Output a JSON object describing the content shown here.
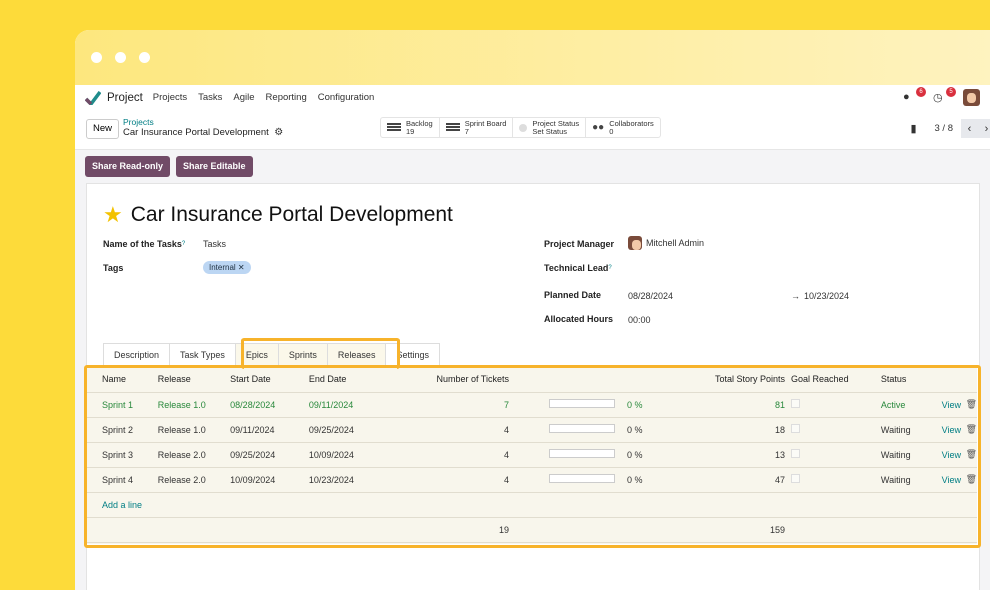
{
  "navbar": {
    "app": "Project",
    "items": [
      "Projects",
      "Tasks",
      "Agile",
      "Reporting",
      "Configuration"
    ],
    "messages_count": "6",
    "activities_count": "5"
  },
  "control_panel": {
    "new_label": "New",
    "breadcrumb_parent": "Projects",
    "breadcrumb_current": "Car Insurance Portal Development",
    "stats": [
      {
        "label": "Backlog",
        "value": "19"
      },
      {
        "label": "Sprint Board",
        "value": "7"
      },
      {
        "label": "Project Status",
        "value": "Set Status"
      },
      {
        "label": "Collaborators",
        "value": "0"
      }
    ],
    "pager": "3 / 8"
  },
  "actions": {
    "share_readonly": "Share Read-only",
    "share_editable": "Share Editable"
  },
  "form": {
    "title": "Car Insurance Portal Development",
    "name_of_tasks_label": "Name of the Tasks",
    "name_of_tasks": "Tasks",
    "tags_label": "Tags",
    "tag": "Internal",
    "project_manager_label": "Project Manager",
    "project_manager": "Mitchell Admin",
    "technical_lead_label": "Technical Lead",
    "planned_date_label": "Planned Date",
    "planned_start": "08/28/2024",
    "planned_end": "10/23/2024",
    "allocated_hours_label": "Allocated Hours",
    "allocated_hours": "00:00"
  },
  "tabs": [
    "Description",
    "Task Types",
    "Epics",
    "Sprints",
    "Releases",
    "Settings"
  ],
  "table": {
    "headers": {
      "name": "Name",
      "release": "Release",
      "start": "Start Date",
      "end": "End Date",
      "tickets": "Number of Tickets",
      "points": "Total Story Points",
      "goal": "Goal Reached",
      "status": "Status"
    },
    "rows": [
      {
        "name": "Sprint 1",
        "release": "Release 1.0",
        "start": "08/28/2024",
        "end": "09/11/2024",
        "tickets": "7",
        "progress": "0 %",
        "points": "81",
        "status": "Active",
        "view": "View"
      },
      {
        "name": "Sprint 2",
        "release": "Release 1.0",
        "start": "09/11/2024",
        "end": "09/25/2024",
        "tickets": "4",
        "progress": "0 %",
        "points": "18",
        "status": "Waiting",
        "view": "View"
      },
      {
        "name": "Sprint 3",
        "release": "Release 2.0",
        "start": "09/25/2024",
        "end": "10/09/2024",
        "tickets": "4",
        "progress": "0 %",
        "points": "13",
        "status": "Waiting",
        "view": "View"
      },
      {
        "name": "Sprint 4",
        "release": "Release 2.0",
        "start": "10/09/2024",
        "end": "10/23/2024",
        "tickets": "4",
        "progress": "0 %",
        "points": "47",
        "status": "Waiting",
        "view": "View"
      }
    ],
    "add_line": "Add a line",
    "total_tickets": "19",
    "total_points": "159"
  },
  "colors": {
    "background": "#FDDB3A",
    "highlight": "#F7B32B",
    "brand": "#714B67",
    "active": "#28883b",
    "link": "#017e84"
  }
}
